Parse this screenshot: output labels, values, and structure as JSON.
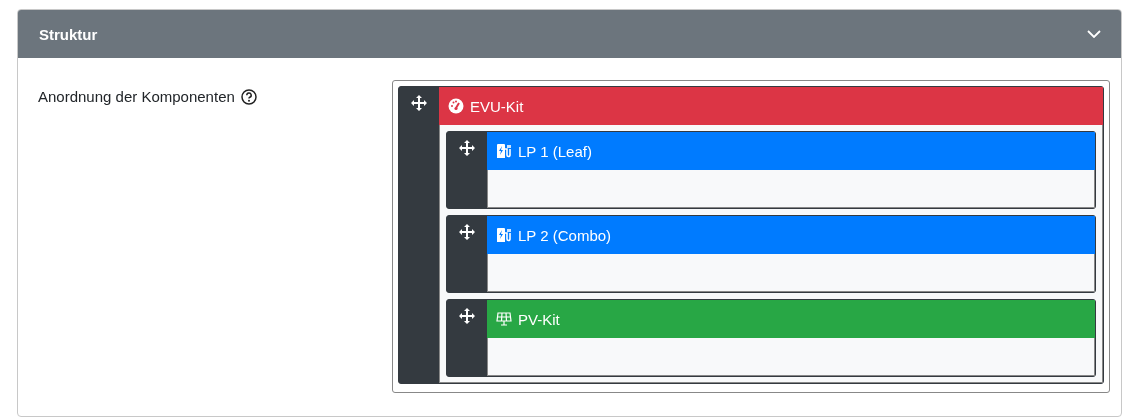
{
  "card": {
    "title": "Struktur",
    "expanded": true
  },
  "field": {
    "label": "Anordnung der Komponenten"
  },
  "tree": [
    {
      "name": "EVU-Kit",
      "kind": "counter",
      "color": "#dc3545",
      "children": [
        {
          "name": "LP 1 (Leaf)",
          "kind": "chargepoint",
          "color": "#007bff"
        },
        {
          "name": "LP 2 (Combo)",
          "kind": "chargepoint",
          "color": "#007bff"
        },
        {
          "name": "PV-Kit",
          "kind": "inverter",
          "color": "#28a745"
        }
      ]
    }
  ]
}
